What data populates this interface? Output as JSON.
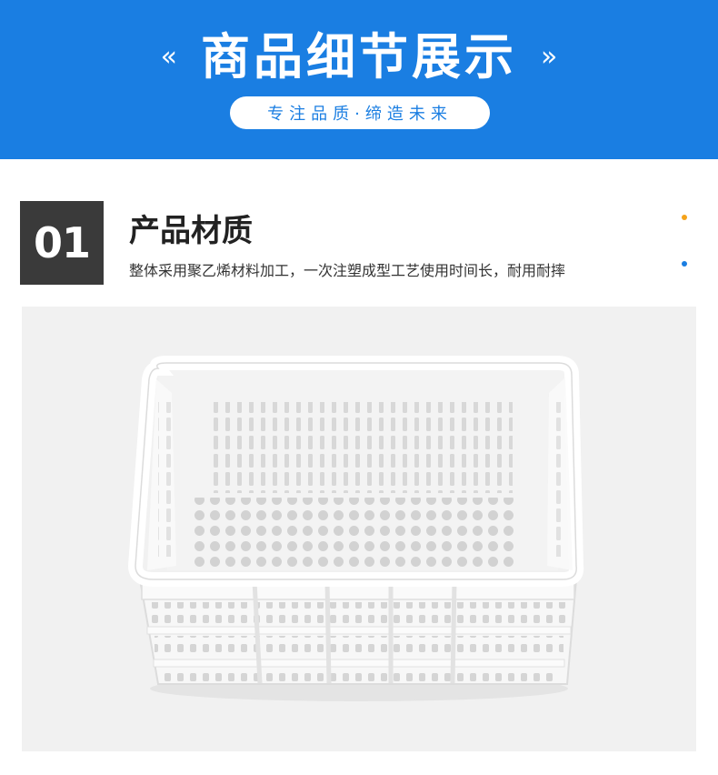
{
  "header": {
    "title": "商品细节展示",
    "chevron_left": "«",
    "chevron_right": "»",
    "subtitle": "专注品质·缔造未来",
    "bg_color": "#1a7ee2"
  },
  "section": {
    "number": "01",
    "title": "产品材质",
    "description": "整体采用聚乙烯材料加工，一次注塑成型工艺使用时间长，耐用耐摔"
  },
  "decor": {
    "dot_colors": [
      "#f5a31a",
      "#1a7ee2"
    ]
  },
  "product_image": {
    "subject": "white plastic basket-icon",
    "bg_color": "#f1f1f1"
  }
}
